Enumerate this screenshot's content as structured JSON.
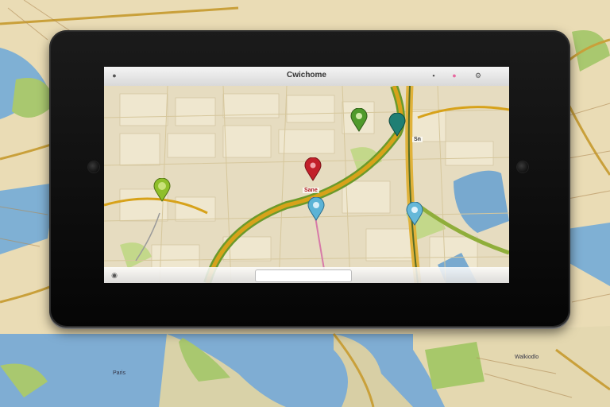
{
  "app": {
    "title": "Cwichome",
    "search_placeholder": "",
    "destination_label": "Sane",
    "street_label": "Sn"
  },
  "background": {
    "label_left": "Paris",
    "label_right": "Walkiodlo"
  },
  "pins": [
    {
      "name": "green",
      "color": "#4f9a2b"
    },
    {
      "name": "teal",
      "color": "#1f7f74"
    },
    {
      "name": "red",
      "color": "#c2202a"
    },
    {
      "name": "blue",
      "color": "#5bb3d6"
    },
    {
      "name": "lime",
      "color": "#8fbf2a"
    },
    {
      "name": "light-blue",
      "color": "#66b8d8"
    }
  ],
  "colors": {
    "route": "#d7a21a",
    "route_green": "#6b9a2b",
    "water": "#78a9cf",
    "park": "#b9d37a"
  }
}
